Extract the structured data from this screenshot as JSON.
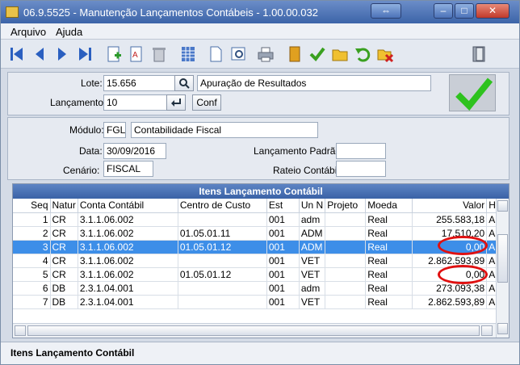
{
  "window": {
    "title": "06.9.5525 - Manutenção Lançamentos Contábeis - 1.00.00.032",
    "btn_restore": "⇔",
    "btn_min": "–",
    "btn_max": "□",
    "btn_close": "✕"
  },
  "menu": {
    "arquivo": "Arquivo",
    "ajuda": "Ajuda"
  },
  "header": {
    "lote_label": "Lote:",
    "lote_value": "15.656",
    "lote_desc": "Apuração de Resultados",
    "lanc_label": "Lançamento:",
    "lanc_value": "10",
    "conf_label": "Conf"
  },
  "detail": {
    "modulo_label": "Módulo:",
    "modulo_code": "FGL",
    "modulo_desc": "Contabilidade Fiscal",
    "data_label": "Data:",
    "data_value": "30/09/2016",
    "cenario_label": "Cenário:",
    "cenario_value": "FISCAL",
    "lanc_padrao_label": "Lançamento Padrão:",
    "lanc_padrao_value": "",
    "rateio_label": "Rateio Contábil:",
    "rateio_value": ""
  },
  "grid": {
    "title": "Itens Lançamento Contábil",
    "columns": [
      "Seq",
      "Natur",
      "Conta Contábil",
      "Centro de Custo",
      "Est",
      "Un N",
      "Projeto",
      "Moeda",
      "Valor",
      "Hist"
    ],
    "rows": [
      [
        "1",
        "CR",
        "3.1.1.06.002",
        "",
        "001",
        "adm",
        "",
        "Real",
        "255.583,18",
        "Apu"
      ],
      [
        "2",
        "CR",
        "3.1.1.06.002",
        "01.05.01.11",
        "001",
        "ADM",
        "",
        "Real",
        "17.510,20",
        "Apu"
      ],
      [
        "3",
        "CR",
        "3.1.1.06.002",
        "01.05.01.12",
        "001",
        "ADM",
        "",
        "Real",
        "0,00",
        "Apu"
      ],
      [
        "4",
        "CR",
        "3.1.1.06.002",
        "",
        "001",
        "VET",
        "",
        "Real",
        "2.862.593,89",
        "Apu"
      ],
      [
        "5",
        "CR",
        "3.1.1.06.002",
        "01.05.01.12",
        "001",
        "VET",
        "",
        "Real",
        "0,00",
        "Apu"
      ],
      [
        "6",
        "DB",
        "2.3.1.04.001",
        "",
        "001",
        "adm",
        "",
        "Real",
        "273.093,38",
        "Apu"
      ],
      [
        "7",
        "DB",
        "2.3.1.04.001",
        "",
        "001",
        "VET",
        "",
        "Real",
        "2.862.593,89",
        "Apu"
      ]
    ],
    "selected_row": 2
  },
  "status": {
    "text": "Itens Lançamento Contábil"
  },
  "toolbar_icons": [
    "first-icon",
    "prev-icon",
    "next-icon",
    "last-icon",
    "new-icon",
    "edit-icon",
    "delete-icon",
    "grid-icon",
    "document-icon",
    "preview-icon",
    "print-icon",
    "book-icon",
    "confirm-icon",
    "folder-icon",
    "undo-icon",
    "cancel-icon",
    "exit-icon"
  ]
}
